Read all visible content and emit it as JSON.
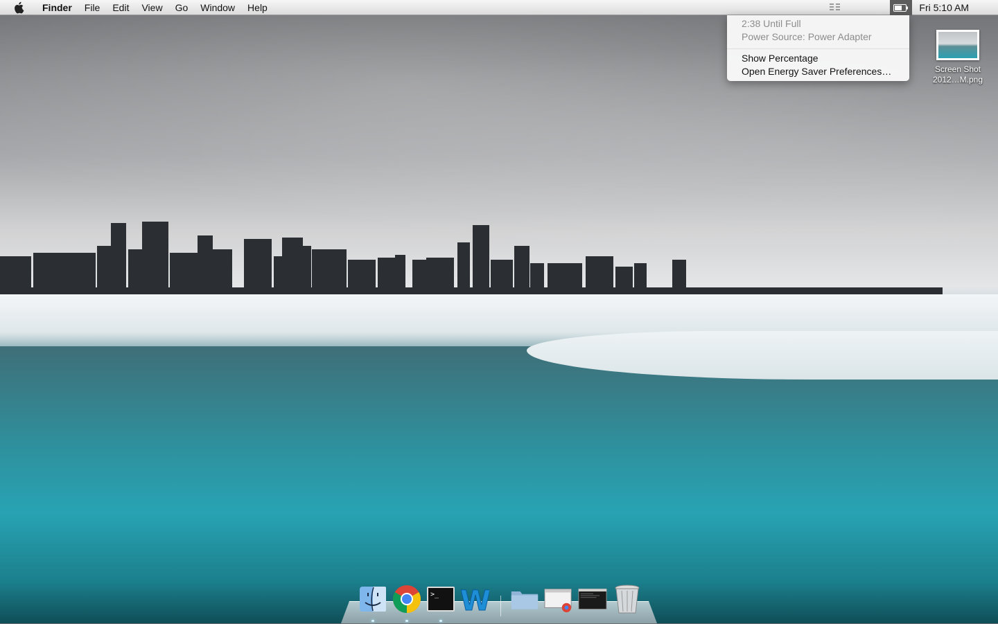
{
  "menubar": {
    "app_name": "Finder",
    "items": [
      "File",
      "Edit",
      "View",
      "Go",
      "Window",
      "Help"
    ],
    "clock": "Fri 5:10 AM"
  },
  "battery_menu": {
    "status_time": "2:38 Until Full",
    "power_source": "Power Source: Power Adapter",
    "show_percentage": "Show Percentage",
    "open_prefs": "Open Energy Saver Preferences…"
  },
  "desktop": {
    "file_label_line1": "Screen Shot",
    "file_label_line2": "2012…M.png"
  },
  "dock": {
    "apps": [
      "finder-icon",
      "chrome-icon",
      "terminal-icon",
      "word-icon"
    ],
    "stacks": [
      "folder-stack-icon",
      "minimized-chrome-window-icon",
      "minimized-terminal-window-icon",
      "trash-icon"
    ]
  }
}
